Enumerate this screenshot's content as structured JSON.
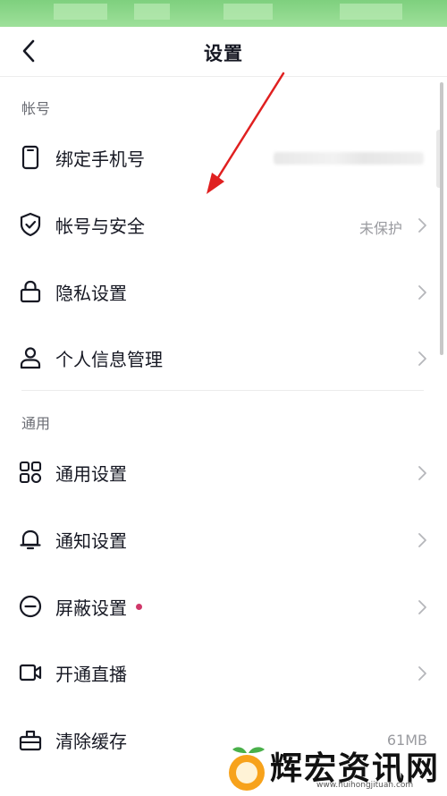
{
  "header": {
    "title": "设置"
  },
  "sections": [
    {
      "title": "帐号"
    },
    {
      "title": "通用"
    }
  ],
  "account_items": [
    {
      "label": "绑定手机号",
      "value": ""
    },
    {
      "label": "帐号与安全",
      "value": "未保护"
    },
    {
      "label": "隐私设置",
      "value": ""
    },
    {
      "label": "个人信息管理",
      "value": ""
    }
  ],
  "general_items": [
    {
      "label": "通用设置",
      "value": ""
    },
    {
      "label": "通知设置",
      "value": ""
    },
    {
      "label": "屏蔽设置",
      "value": ""
    },
    {
      "label": "开通直播",
      "value": ""
    },
    {
      "label": "清除缓存",
      "value": "61MB"
    }
  ],
  "watermark": {
    "text": "辉宏资讯网",
    "url": "www.huihongjituan.com"
  },
  "colors": {
    "annotation_arrow": "#e02020",
    "badge_dot": "#d0386a",
    "status_bar": "#7ed07e"
  }
}
